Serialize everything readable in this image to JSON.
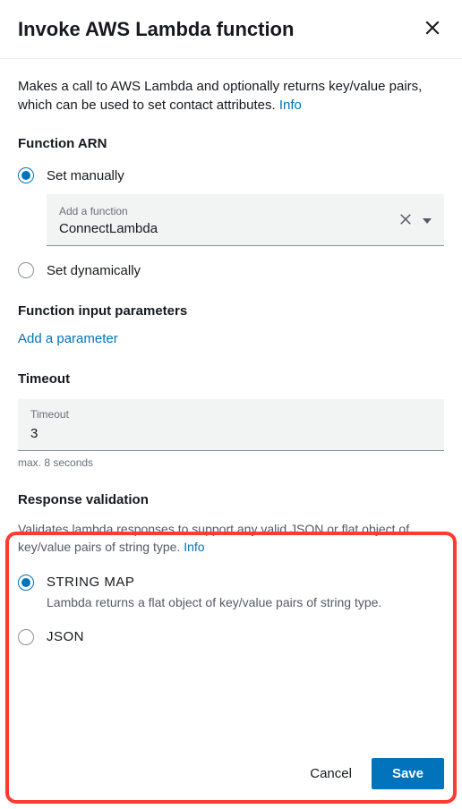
{
  "header": {
    "title": "Invoke AWS Lambda function"
  },
  "description": {
    "text": "Makes a call to AWS Lambda and optionally returns key/value pairs, which can be used to set contact attributes.",
    "info_label": "Info"
  },
  "function_arn": {
    "label": "Function ARN",
    "options": {
      "manual": {
        "label": "Set manually",
        "selected": true,
        "dropdown_label": "Add a function",
        "dropdown_value": "ConnectLambda"
      },
      "dynamic": {
        "label": "Set dynamically",
        "selected": false
      }
    }
  },
  "input_params": {
    "label": "Function input parameters",
    "add_link": "Add a parameter"
  },
  "timeout": {
    "section_label": "Timeout",
    "field_label": "Timeout",
    "value": "3",
    "hint": "max. 8 seconds"
  },
  "response_validation": {
    "label": "Response validation",
    "description": "Validates lambda responses to support any valid JSON or flat object of key/value pairs of string type.",
    "info_label": "Info",
    "options": {
      "string_map": {
        "label": "STRING MAP",
        "sub": "Lambda returns a flat object of key/value pairs of string type.",
        "selected": true
      },
      "json": {
        "label": "JSON",
        "selected": false
      }
    }
  },
  "footer": {
    "cancel": "Cancel",
    "save": "Save"
  }
}
